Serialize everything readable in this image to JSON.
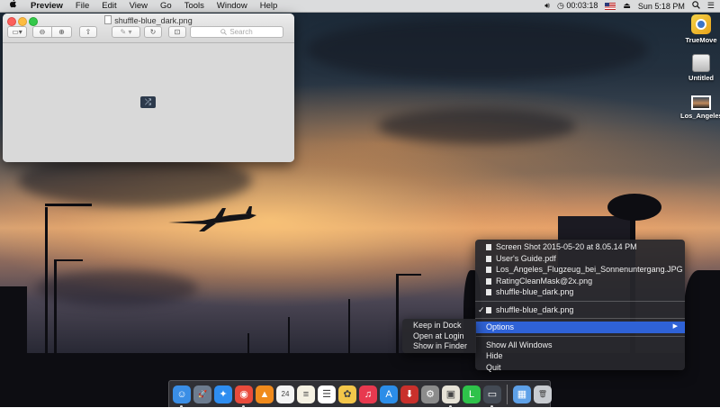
{
  "menubar": {
    "apple": "",
    "app_name": "Preview",
    "items": [
      "File",
      "Edit",
      "View",
      "Go",
      "Tools",
      "Window",
      "Help"
    ],
    "timer": "00:03:18",
    "clock": "Sun 5:18 PM"
  },
  "desktop_icons": [
    {
      "label": "TrueMove",
      "icon": "truemove-app-icon"
    },
    {
      "label": "Untitled",
      "icon": "drive-icon"
    },
    {
      "label": "Los_Angeles_F....JPG",
      "icon": "image-file-icon"
    }
  ],
  "preview_window": {
    "title": "shuffle-blue_dark.png",
    "search_placeholder": "Search",
    "image_symbol": "⤮"
  },
  "dock": {
    "apps": [
      {
        "name": "finder-icon",
        "glyph": "☺",
        "color": "#3a8ee6",
        "running": true
      },
      {
        "name": "launchpad-icon",
        "glyph": "🚀",
        "color": "#6d7c8f",
        "running": false
      },
      {
        "name": "safari-icon",
        "glyph": "✦",
        "color": "#2e8df0",
        "running": false
      },
      {
        "name": "chrome-icon",
        "glyph": "◉",
        "color": "#e94b3c",
        "running": true
      },
      {
        "name": "vlc-icon",
        "glyph": "▲",
        "color": "#f08a1c",
        "running": false
      },
      {
        "name": "calendar-icon",
        "glyph": "24",
        "color": "#f4f4f4",
        "running": false
      },
      {
        "name": "notes-icon",
        "glyph": "≡",
        "color": "#f5f1e3",
        "running": false
      },
      {
        "name": "reminders-icon",
        "glyph": "☰",
        "color": "#ffffff",
        "running": false
      },
      {
        "name": "photos-icon",
        "glyph": "✿",
        "color": "#f3c64a",
        "running": false
      },
      {
        "name": "itunes-icon",
        "glyph": "♫",
        "color": "#e8394f",
        "running": false
      },
      {
        "name": "app-store-icon",
        "glyph": "A",
        "color": "#2b8de8",
        "running": false
      },
      {
        "name": "downloader-icon",
        "glyph": "⬇",
        "color": "#c9302c",
        "running": false
      },
      {
        "name": "system-preferences-icon",
        "glyph": "⚙",
        "color": "#8c8c8c",
        "running": false
      },
      {
        "name": "preview-icon",
        "glyph": "▣",
        "color": "#e6e2d6",
        "running": true
      },
      {
        "name": "line-icon",
        "glyph": "L",
        "color": "#2ec24a",
        "running": false
      },
      {
        "name": "terminal-screen-icon",
        "glyph": "▭",
        "color": "#444b55",
        "running": true
      }
    ],
    "trailing": [
      {
        "name": "applications-folder-icon",
        "glyph": "▦",
        "color": "#5ea1e8"
      },
      {
        "name": "trash-icon",
        "glyph": "🗑",
        "color": "#c9ccd1"
      }
    ]
  },
  "dock_menu": {
    "recent_files": [
      "Screen Shot 2015-05-20 at 8.05.14 PM",
      "User's Guide.pdf",
      "Los_Angeles_Flugzeug_bei_Sonnenuntergang.JPG",
      "RatingCleanMask@2x.png",
      "shuffle-blue_dark.png"
    ],
    "open_window": "shuffle-blue_dark.png",
    "open_window_check": "✓",
    "options": "Options",
    "options_arrow": "▶",
    "show_all": "Show All Windows",
    "hide": "Hide",
    "quit": "Quit"
  },
  "options_submenu": {
    "items": [
      "Keep in Dock",
      "Open at Login",
      "Show in Finder"
    ]
  }
}
